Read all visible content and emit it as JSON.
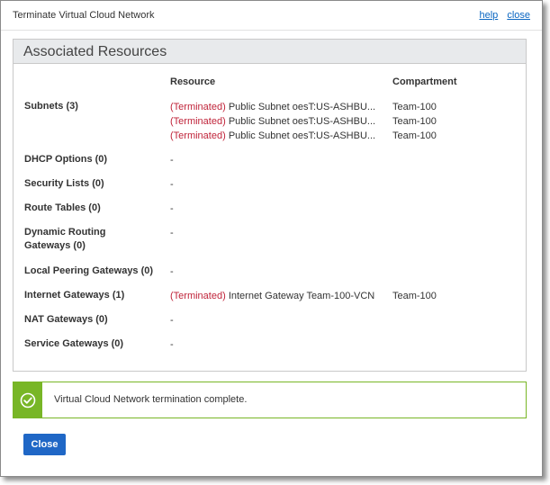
{
  "dialog": {
    "title": "Terminate Virtual Cloud Network",
    "help_link": "help",
    "close_link": "close"
  },
  "section": {
    "title": "Associated Resources",
    "columns": {
      "resource": "Resource",
      "compartment": "Compartment"
    }
  },
  "rows": [
    {
      "label": "Subnets (3)",
      "items": [
        {
          "status": "(Terminated)",
          "resource": "Public Subnet oesT:US-ASHBU...",
          "compartment": "Team-100"
        },
        {
          "status": "(Terminated)",
          "resource": "Public Subnet oesT:US-ASHBU...",
          "compartment": "Team-100"
        },
        {
          "status": "(Terminated)",
          "resource": "Public Subnet oesT:US-ASHBU...",
          "compartment": "Team-100"
        }
      ]
    },
    {
      "label": "DHCP Options (0)",
      "empty": "-"
    },
    {
      "label": "Security Lists (0)",
      "empty": "-"
    },
    {
      "label": "Route Tables (0)",
      "empty": "-"
    },
    {
      "label_line1": "Dynamic Routing",
      "label_line2": "Gateways (0)",
      "empty": "-"
    },
    {
      "label": "Local Peering Gateways (0)",
      "empty": "-"
    },
    {
      "label": "Internet Gateways (1)",
      "items": [
        {
          "status": "(Terminated)",
          "resource": "Internet Gateway Team-100-VCN",
          "compartment": "Team-100"
        }
      ]
    },
    {
      "label": "NAT Gateways (0)",
      "empty": "-"
    },
    {
      "label": "Service Gateways (0)",
      "empty": "-"
    }
  ],
  "alert": {
    "message": "Virtual Cloud Network termination complete.",
    "icon": "check-circle-icon",
    "color": "#78b626"
  },
  "footer": {
    "close_button": "Close"
  },
  "colors": {
    "link": "#0a66c2",
    "terminated": "#c0243a",
    "primary_button": "#1f67c6",
    "success": "#78b626"
  }
}
